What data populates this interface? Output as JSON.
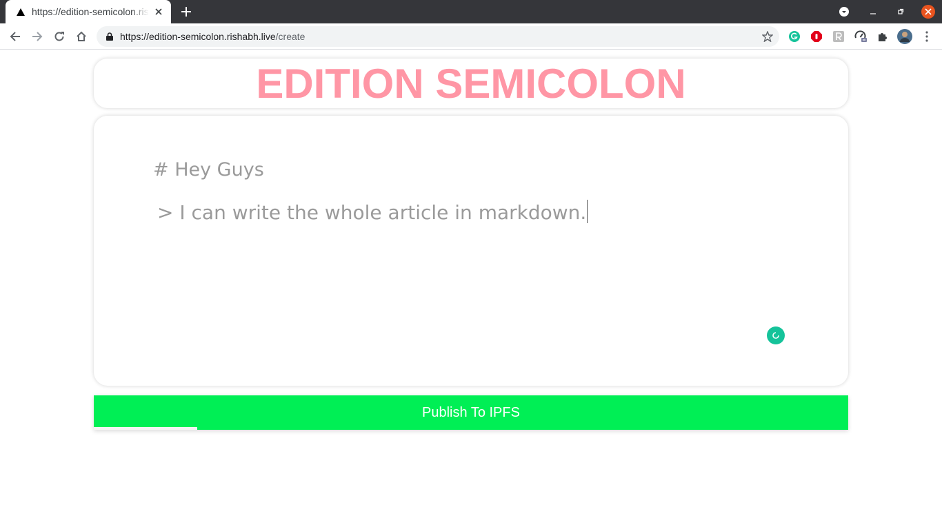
{
  "browser": {
    "tab": {
      "title": "https://edition-semicolon.rishabh.live/create"
    },
    "address": {
      "host": "https://edition-semicolon.rishabh.live",
      "path": "/create"
    }
  },
  "page": {
    "site_title": "EDITION SEMICOLON",
    "editor": {
      "line1": "# Hey Guys",
      "line2": " > I can write the whole article in markdown."
    },
    "publish_label": "Publish To IPFS"
  },
  "colors": {
    "title_pink": "#ff96a5",
    "publish_green": "#00ef55",
    "grammarly_teal": "#15c39a"
  }
}
